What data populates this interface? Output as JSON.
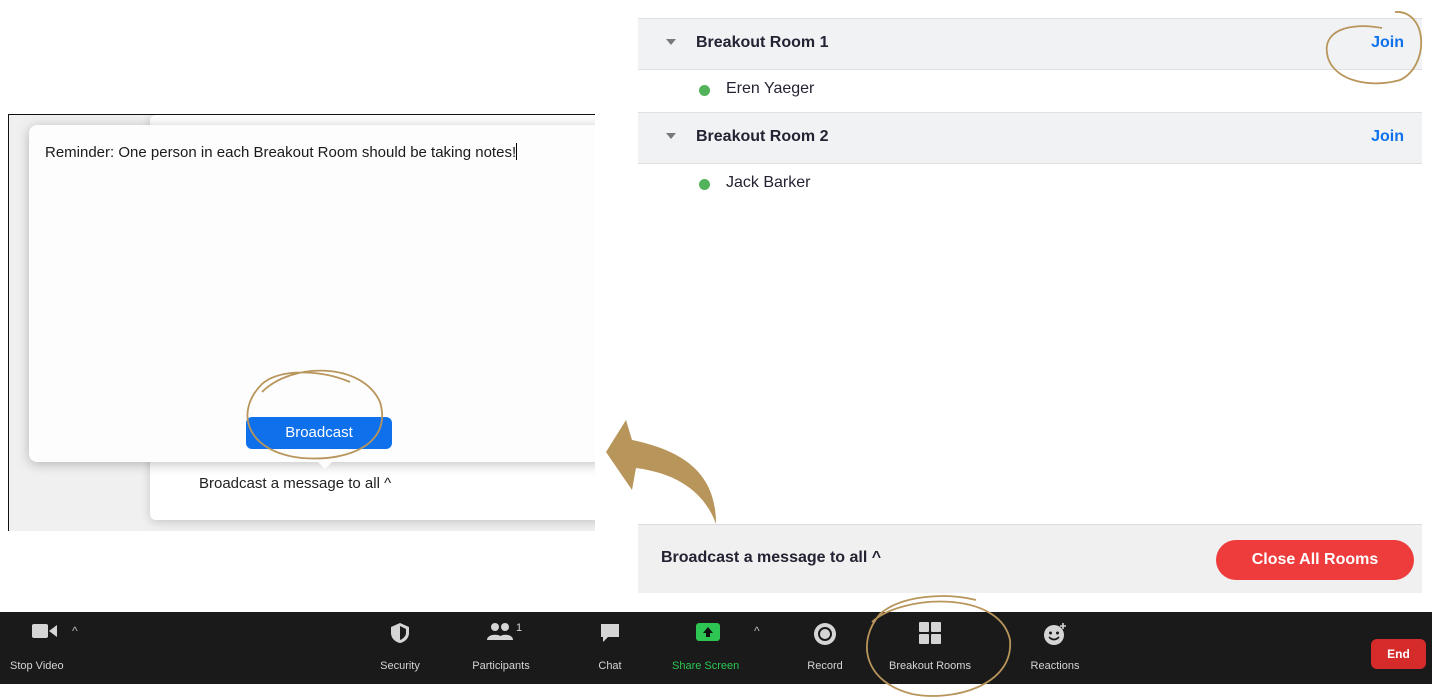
{
  "composer": {
    "message": "Reminder: One person in each Breakout Room should be taking notes!",
    "broadcast_label": "Broadcast",
    "footer_label": "Broadcast a message to all",
    "footer_caret": "^"
  },
  "rooms": [
    {
      "name": "Breakout Room 1",
      "join_label": "Join",
      "participants": [
        {
          "name": "Eren Yaeger"
        }
      ]
    },
    {
      "name": "Breakout Room 2",
      "join_label": "Join",
      "participants": [
        {
          "name": "Jack Barker"
        }
      ]
    }
  ],
  "rooms_footer": {
    "message_label": "Broadcast a message to all",
    "message_caret": "^",
    "close_label": "Close All Rooms"
  },
  "toolbar": {
    "stop_video": "Stop Video",
    "security": "Security",
    "participants": "Participants",
    "participants_count": "1",
    "chat": "Chat",
    "share_screen": "Share Screen",
    "record": "Record",
    "breakout_rooms": "Breakout Rooms",
    "reactions": "Reactions",
    "end": "End"
  },
  "colors": {
    "accent_blue": "#0e71eb",
    "close_red": "#ee3b3b",
    "share_green": "#2dc653",
    "annotation_gold": "#b8955a",
    "toolbar_bg": "#1a1a1a"
  }
}
